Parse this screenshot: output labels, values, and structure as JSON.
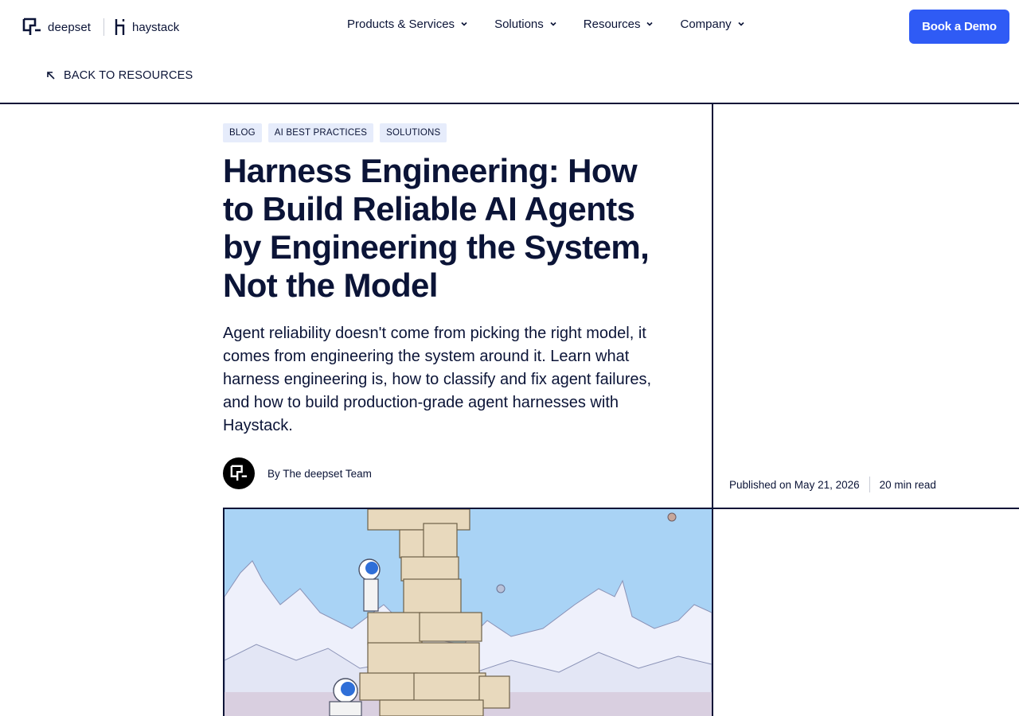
{
  "header": {
    "logo_deepset": "deepset",
    "logo_haystack": "haystack",
    "nav": [
      {
        "label": "Products & Services"
      },
      {
        "label": "Solutions"
      },
      {
        "label": "Resources"
      },
      {
        "label": "Company"
      }
    ],
    "cta_label": "Book a Demo"
  },
  "back_link": "BACK TO RESOURCES",
  "article": {
    "tags": [
      "BLOG",
      "AI BEST PRACTICES",
      "SOLUTIONS"
    ],
    "title": "Harness Engineering: How to Build Reliable AI Agents by Engineering the System, Not the Model",
    "subtitle": "Agent reliability doesn't come from picking the right model, it comes from engineering the system around it. Learn what harness engineering is, how to classify and fix agent failures, and how to build production-grade agent harnesses with Haystack.",
    "author": "By The deepset Team",
    "published": "Published on May 21, 2026",
    "read_time": "20 min read"
  },
  "colors": {
    "ink": "#0b1437",
    "accent": "#2f5bf5",
    "tag_bg": "#e6ecfb",
    "sky": "#a9d3f5"
  }
}
